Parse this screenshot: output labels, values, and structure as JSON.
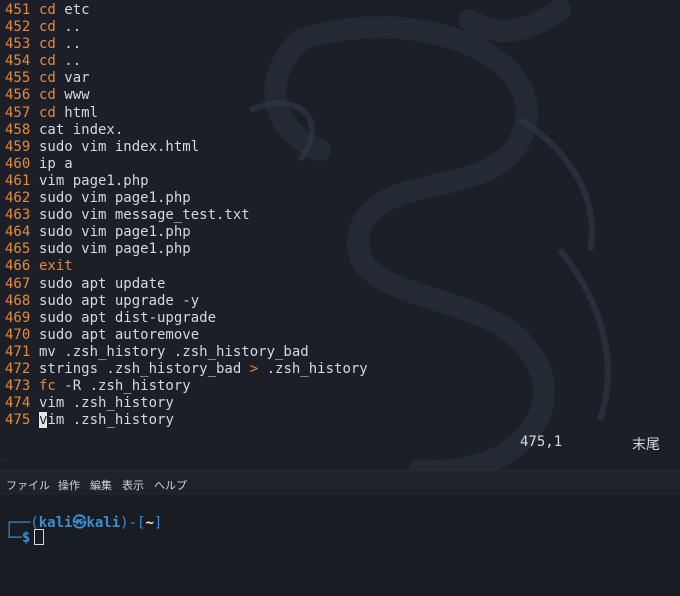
{
  "vim": {
    "lines": [
      {
        "num": "451",
        "cmd": "cd",
        "rest": " etc",
        "hl": true
      },
      {
        "num": "452",
        "cmd": "cd",
        "rest": " ..",
        "hl": true
      },
      {
        "num": "453",
        "cmd": "cd",
        "rest": " ..",
        "hl": true
      },
      {
        "num": "454",
        "cmd": "cd",
        "rest": " ..",
        "hl": true
      },
      {
        "num": "455",
        "cmd": "cd",
        "rest": " var",
        "hl": true
      },
      {
        "num": "456",
        "cmd": "cd",
        "rest": " www",
        "hl": true
      },
      {
        "num": "457",
        "cmd": "cd",
        "rest": " html",
        "hl": true
      },
      {
        "num": "458",
        "cmd": "",
        "rest": "cat index.",
        "hl": false
      },
      {
        "num": "459",
        "cmd": "",
        "rest": "sudo vim index.html",
        "hl": false
      },
      {
        "num": "460",
        "cmd": "",
        "rest": "ip a",
        "hl": false
      },
      {
        "num": "461",
        "cmd": "",
        "rest": "vim page1.php",
        "hl": false
      },
      {
        "num": "462",
        "cmd": "",
        "rest": "sudo vim page1.php",
        "hl": false
      },
      {
        "num": "463",
        "cmd": "",
        "rest": "sudo vim message_test.txt",
        "hl": false
      },
      {
        "num": "464",
        "cmd": "",
        "rest": "sudo vim page1.php",
        "hl": false
      },
      {
        "num": "465",
        "cmd": "",
        "rest": "sudo vim page1.php",
        "hl": false
      },
      {
        "num": "466",
        "cmd": "exit",
        "rest": "",
        "hl": true
      },
      {
        "num": "467",
        "cmd": "",
        "rest": "sudo apt update",
        "hl": false
      },
      {
        "num": "468",
        "cmd": "",
        "rest": "sudo apt upgrade -y",
        "hl": false
      },
      {
        "num": "469",
        "cmd": "",
        "rest": "sudo apt dist-upgrade",
        "hl": false
      },
      {
        "num": "470",
        "cmd": "",
        "rest": "sudo apt autoremove",
        "hl": false
      },
      {
        "num": "471",
        "cmd": "",
        "rest": "mv .zsh_history .zsh_history_bad",
        "hl": false
      },
      {
        "num": "472",
        "cmd": "",
        "rest": "strings .zsh_history_bad ",
        "hl": false,
        "redir": ">",
        "after": " .zsh_history"
      },
      {
        "num": "473",
        "cmd": "fc",
        "rest": " -R .zsh_history",
        "hl": true
      },
      {
        "num": "474",
        "cmd": "",
        "rest": "vim .zsh_history",
        "hl": false
      },
      {
        "num": "475",
        "cmd": "",
        "rest": "im .zsh_history",
        "hl": false,
        "cursorChar": "v"
      }
    ],
    "ruler_position": "475,1",
    "ruler_mode": "末尾"
  },
  "menubar": {
    "items": [
      "ファイル",
      "操作",
      "編集",
      "表示",
      "ヘルプ"
    ]
  },
  "terminal": {
    "frame_top_left": "┌──(",
    "user": "kali",
    "skull": "㉿",
    "host": "kali",
    "frame_mid": ")-[",
    "dir": "~",
    "frame_end": "]",
    "frame_bottom_left": "└─",
    "dollar": "$"
  },
  "colors": {
    "accent_orange": "#e58a3c",
    "prompt_blue": "#3b8fd0",
    "background": "#1c1f27"
  }
}
